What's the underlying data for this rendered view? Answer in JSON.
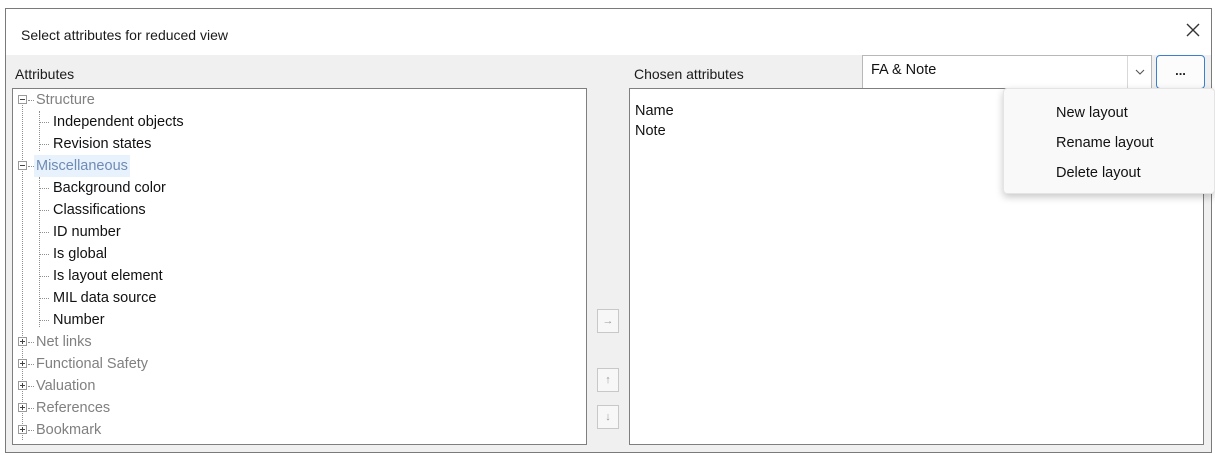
{
  "dialog": {
    "title": "Select attributes for reduced view"
  },
  "attributes_panel": {
    "label": "Attributes",
    "tree": [
      {
        "label": "Structure",
        "expanded": true,
        "children": [
          "Independent objects",
          "Revision states"
        ]
      },
      {
        "label": "Miscellaneous",
        "expanded": true,
        "selected": true,
        "children": [
          "Background color",
          "Classifications",
          "ID number",
          "Is global",
          "Is layout element",
          "MIL data source",
          "Number"
        ]
      },
      {
        "label": "Net links",
        "expanded": false
      },
      {
        "label": "Functional Safety",
        "expanded": false
      },
      {
        "label": "Valuation",
        "expanded": false
      },
      {
        "label": "References",
        "expanded": false
      },
      {
        "label": "Bookmark",
        "expanded": false
      }
    ]
  },
  "chosen_panel": {
    "label": "Chosen attributes",
    "items": [
      "Name",
      "Note"
    ]
  },
  "layout_combo": {
    "value": "FA & Note",
    "more_label": "..."
  },
  "side_buttons": {
    "add": "→",
    "up": "↑",
    "down": "↓"
  },
  "context_menu": {
    "items": [
      "New layout",
      "Rename layout",
      "Delete layout"
    ]
  },
  "icons": {
    "close": "close-icon",
    "dropdown": "chevron-down-icon"
  },
  "colors": {
    "selection_bg": "#e8f2fc",
    "selection_text": "#6f8bb5",
    "group_text": "#808080",
    "accent_border": "#3a7fd1"
  }
}
